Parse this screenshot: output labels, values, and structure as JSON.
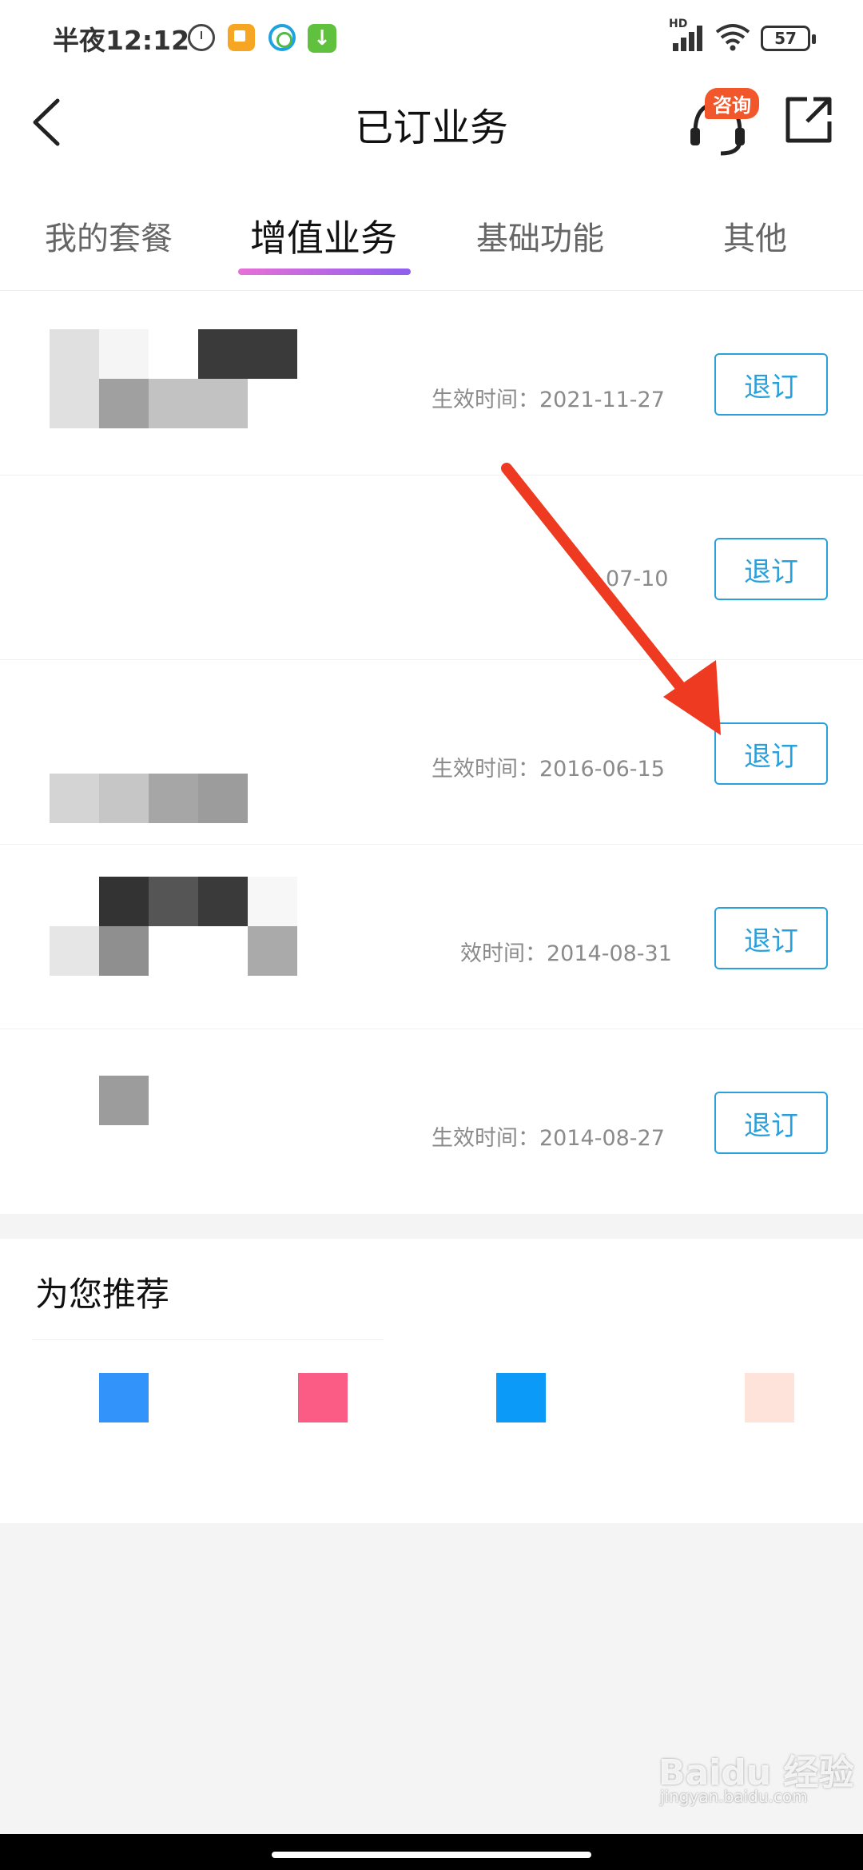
{
  "status_bar": {
    "time": "半夜12:12",
    "battery": "57",
    "network_label": "HD"
  },
  "header": {
    "title": "已订业务",
    "consult_badge": "咨询"
  },
  "tabs": [
    {
      "label": "我的套餐",
      "active": false
    },
    {
      "label": "增值业务",
      "active": true
    },
    {
      "label": "基础功能",
      "active": false
    },
    {
      "label": "其他",
      "active": false
    }
  ],
  "subscriptions": [
    {
      "date_text": "生效时间：2021-11-27",
      "button": "退订"
    },
    {
      "date_text": "07-10",
      "button": "退订"
    },
    {
      "date_text": "生效时间：2016-06-15",
      "button": "退订"
    },
    {
      "date_text": "效时间：2014-08-31",
      "button": "退订"
    },
    {
      "date_text": "生效时间：2014-08-27",
      "button": "退订"
    }
  ],
  "recommend": {
    "title": "为您推荐"
  },
  "colors": {
    "accent": "#2aa0db",
    "tab_indicator_start": "#e770d6",
    "tab_indicator_end": "#8e5ff0",
    "arrow": "#ee3a20",
    "rec_icons": [
      "#3293fb",
      "#fb5c86",
      "#0b9af7",
      "#fde3da"
    ]
  },
  "watermark": {
    "text": "Baidu 经验",
    "sub": "jingyan.baidu.com"
  }
}
